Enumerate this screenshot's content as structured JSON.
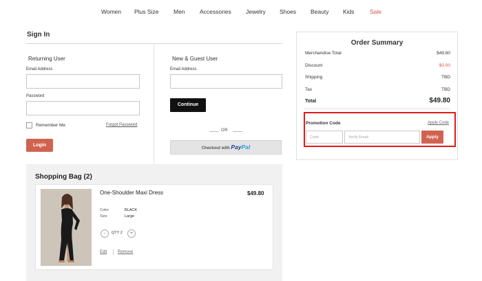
{
  "nav": {
    "items": [
      "Women",
      "Plus Size",
      "Men",
      "Accessories",
      "Jewelry",
      "Shoes",
      "Beauty",
      "Kids",
      "Sale"
    ],
    "sale_color": "#d9534f"
  },
  "signin": {
    "title": "Sign In",
    "returning": {
      "title": "Returning User",
      "email_label": "Email Address",
      "email_value": "",
      "password_label": "Password",
      "password_value": "",
      "remember_label": "Remember Me",
      "remember_checked": false,
      "forgot_link": "Forgot Password",
      "login_button": "Login"
    },
    "guest": {
      "title": "New & Guest User",
      "email_label": "Email Address",
      "email_value": "",
      "continue_button": "Continue",
      "or_text": "OR",
      "paypal_prefix": "Checkout with",
      "paypal_brand_1": "Pay",
      "paypal_brand_2": "Pal"
    }
  },
  "bag": {
    "title": "Shopping Bag (2)",
    "item": {
      "image_icon": "product-photo",
      "name": "One-Shoulder Maxi Dress",
      "price": "$49.80",
      "color_label": "Color",
      "color_value": "BLACK",
      "size_label": "Size",
      "size_value": "Large",
      "minus": "-",
      "qty_text": "QTY 2",
      "plus": "+",
      "edit": "Edit",
      "remove": "Remove"
    }
  },
  "summary": {
    "title": "Order Summary",
    "rows": [
      {
        "label": "Merchandise Total",
        "value": "$49.80"
      },
      {
        "label": "Discount",
        "value": "$0.00"
      },
      {
        "label": "Shipping",
        "value": "TBD"
      },
      {
        "label": "Tax",
        "value": "TBD"
      }
    ],
    "total_label": "Total",
    "total_value": "$49.80",
    "promo": {
      "label": "Promotion Code",
      "apply_code_link": "Apply Code",
      "code_placeholder": "Code",
      "email_placeholder": "Verify Email",
      "apply_button": "Apply"
    }
  },
  "colors": {
    "accent": "#d0634f",
    "highlight_border": "#e01919",
    "discount": "#d9534f"
  }
}
